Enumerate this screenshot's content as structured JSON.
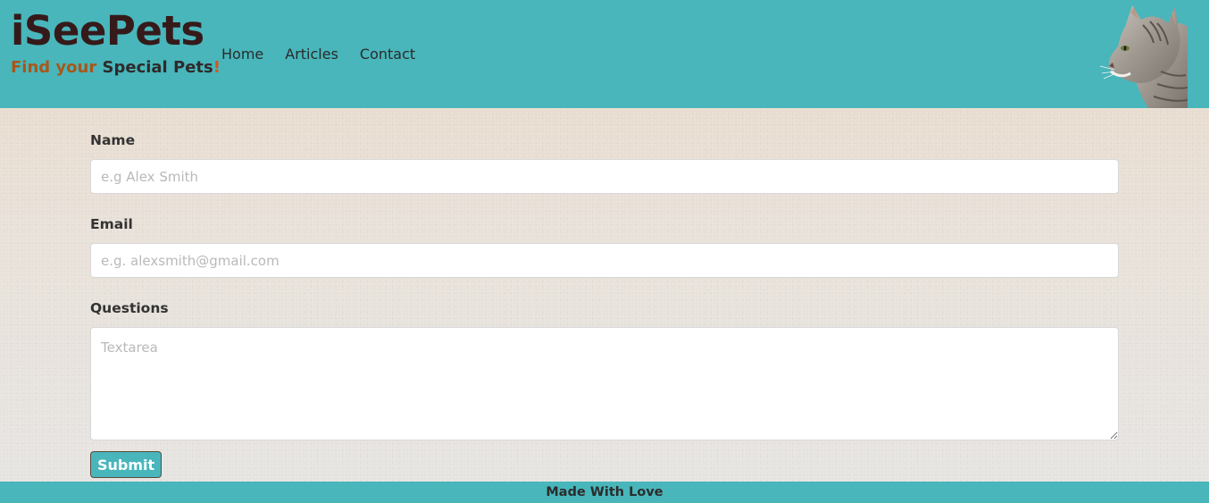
{
  "brand": {
    "title": "iSeePets",
    "tagline_part1": "Find your",
    "tagline_part2": "Special Pets",
    "tagline_part3": "!"
  },
  "nav": {
    "items": [
      {
        "label": "Home"
      },
      {
        "label": "Articles"
      },
      {
        "label": "Contact"
      }
    ]
  },
  "header_image": {
    "icon": "cat-photo"
  },
  "form": {
    "name_label": "Name",
    "name_placeholder": "e.g Alex Smith",
    "email_label": "Email",
    "email_placeholder": "e.g. alexsmith@gmail.com",
    "questions_label": "Questions",
    "questions_placeholder": "Textarea",
    "submit_label": "Submit"
  },
  "footer": {
    "text": "Made With Love"
  },
  "colors": {
    "accent": "#48b6bb",
    "brand_dark": "#361a1a",
    "tagline_orange": "#a8571a"
  }
}
